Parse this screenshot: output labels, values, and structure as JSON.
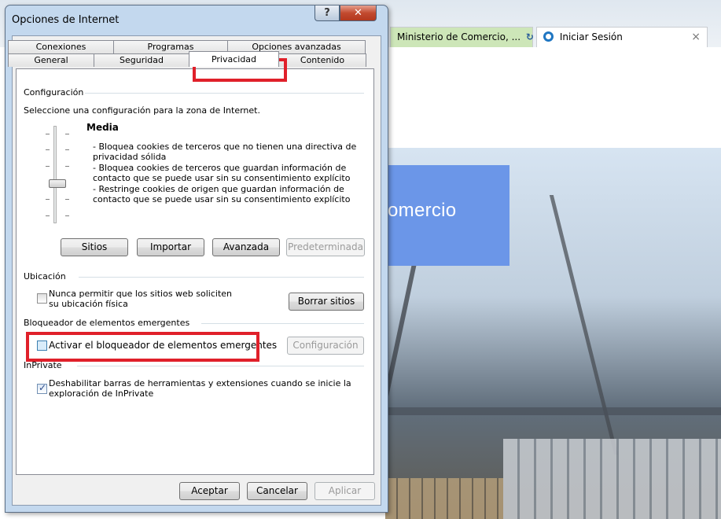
{
  "browser": {
    "tab1_label": "Ministerio de Comercio, ...",
    "tab1_refresh": "↻",
    "tab2_label": "Iniciar Sesión",
    "tab2_close": "×",
    "hero_text": "omercio"
  },
  "dialog": {
    "title": "Opciones de Internet",
    "help_label": "?",
    "close_label": "✕",
    "tabs_row1": [
      "Conexiones",
      "Programas",
      "Opciones avanzadas"
    ],
    "tabs_row2": [
      "General",
      "Seguridad",
      "Privacidad",
      "Contenido"
    ],
    "active_tab": "Privacidad"
  },
  "config": {
    "group_label": "Configuración",
    "intro": "Seleccione una configuración para la zona de Internet.",
    "level": "Media",
    "lines": [
      "- Bloquea cookies de terceros que no tienen una directiva de",
      "privacidad sólida",
      "- Bloquea cookies de terceros que guardan información de",
      "contacto que se puede usar sin su consentimiento explícito",
      "- Restringe cookies de origen que guardan información de",
      "contacto que se puede usar sin su consentimiento explícito"
    ],
    "buttons": [
      "Sitios",
      "Importar",
      "Avanzada",
      "Predeterminada"
    ]
  },
  "location": {
    "group_label": "Ubicación",
    "checkbox_line1": "Nunca permitir que los sitios web soliciten",
    "checkbox_line2": "su ubicación física",
    "clear_button": "Borrar sitios"
  },
  "popup": {
    "group_label": "Bloqueador de elementos emergentes",
    "checkbox_label": "Activar el bloqueador de elementos emergentes",
    "config_button": "Configuración"
  },
  "inprivate": {
    "group_label": "InPrivate",
    "checkbox_line1": "Deshabilitar barras de herramientas y extensiones cuando se inicie la",
    "checkbox_line2": "exploración de InPrivate"
  },
  "footer": {
    "ok": "Aceptar",
    "cancel": "Cancelar",
    "apply": "Aplicar"
  },
  "colors": {
    "highlight": "#e0202a",
    "brand_box": "#6b96e8"
  }
}
